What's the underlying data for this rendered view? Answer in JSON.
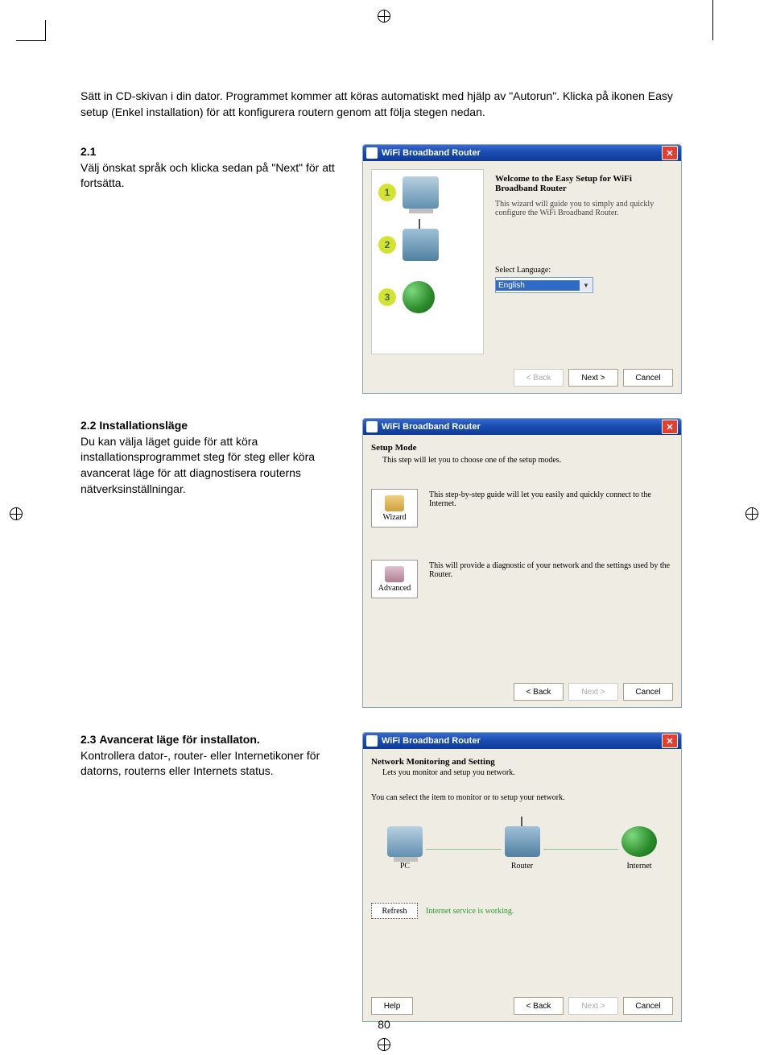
{
  "page_number": "80",
  "intro": "Sätt in CD-skivan i din dator. Programmet kommer att köras automatiskt med hjälp av \"Autorun\". Klicka på ikonen Easy setup (Enkel installation) för att konfigurera routern genom att följa stegen nedan.",
  "s1": {
    "num": "2.1",
    "text": "Välj önskat språk och klicka sedan på \"Next\" för att fortsätta."
  },
  "s2": {
    "num": "2.2",
    "title": "Installationsläge",
    "text": "Du kan välja läget guide för att köra installationsprogrammet steg för steg eller köra avancerat läge för att diagnostisera routerns nätverksinställningar."
  },
  "s3": {
    "num": "2.3",
    "title": "Avancerat läge för installaton.",
    "text": "Kontrollera dator-, router- eller Internetikoner för datorns, routerns eller Internets status."
  },
  "win_title": "WiFi Broadband Router",
  "btn": {
    "back": "< Back",
    "next": "Next >",
    "cancel": "Cancel",
    "help": "Help",
    "refresh": "Refresh"
  },
  "w1": {
    "title": "Welcome to the Easy Setup for WiFi Broadband Router",
    "desc": "This wizard will guide you to simply and quickly configure the WiFi Broadband Router.",
    "lang_label": "Select Language:",
    "lang_value": "English",
    "steps": [
      "1",
      "2",
      "3"
    ]
  },
  "w2": {
    "head": "Setup Mode",
    "sub": "This step will let you to choose one of the setup modes.",
    "wizard_label": "Wizard",
    "wizard_desc": "This step-by-step guide will let you easily and quickly connect to the Internet.",
    "advanced_label": "Advanced",
    "advanced_desc": "This will provide a diagnostic of your network and the settings used by the Router."
  },
  "w3": {
    "head": "Network Monitoring and Setting",
    "sub": "Lets you monitor and setup you network.",
    "msg": "You can select the item to monitor or to setup your network.",
    "pc": "PC",
    "router": "Router",
    "internet": "Internet",
    "status": "Internet service is working."
  }
}
